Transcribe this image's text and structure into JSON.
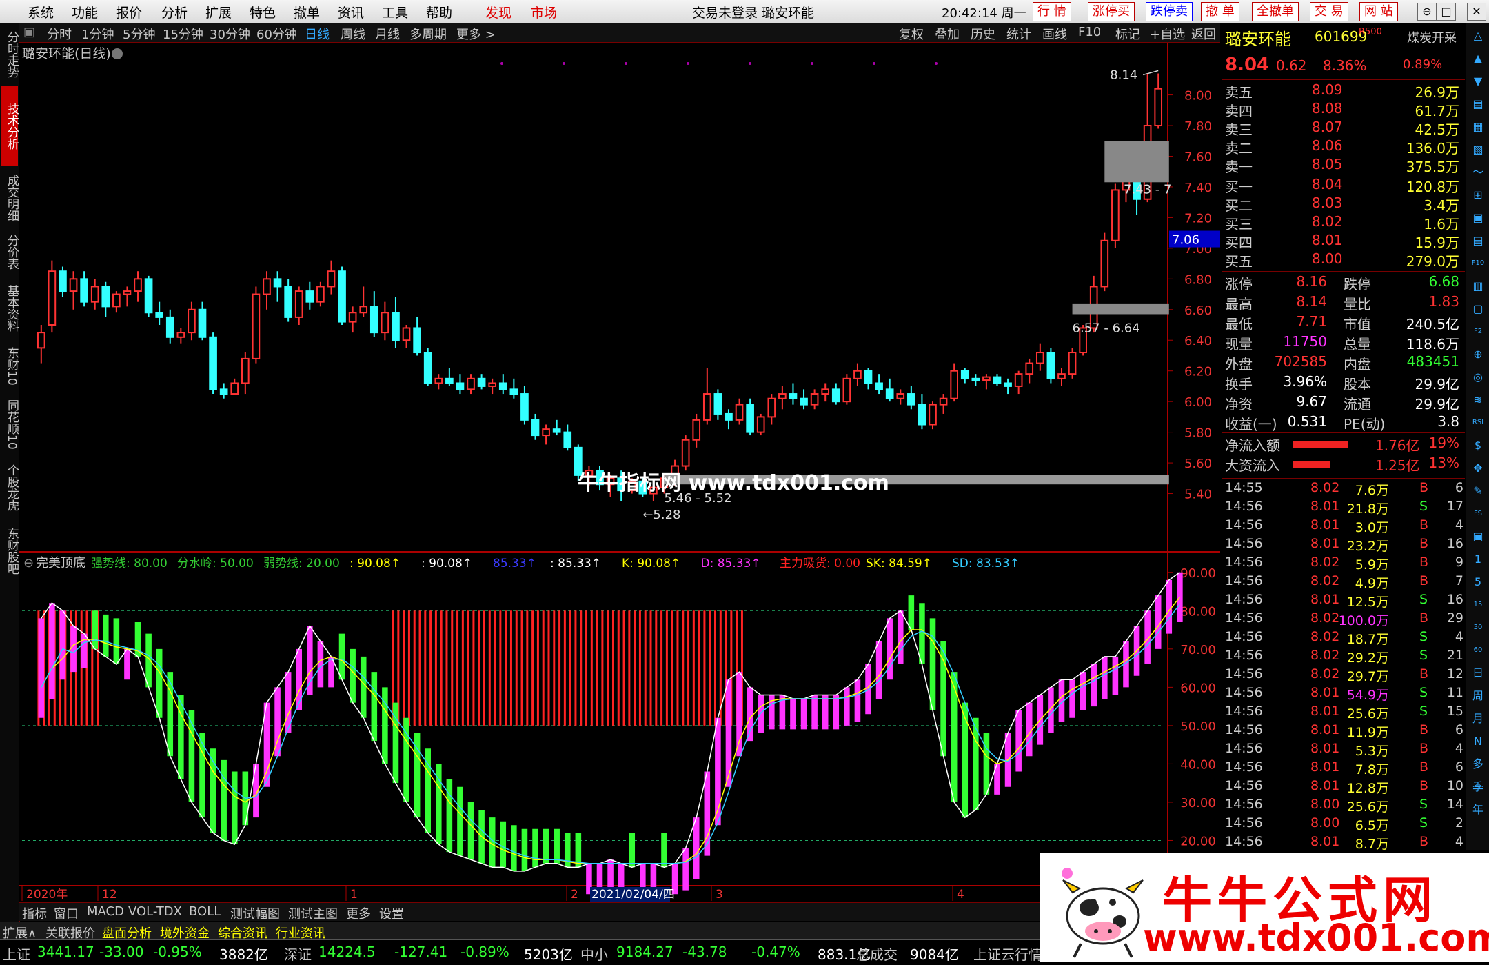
{
  "menu": {
    "items": [
      "系统",
      "功能",
      "报价",
      "分析",
      "扩展",
      "特色",
      "撤单",
      "资讯",
      "工具",
      "帮助"
    ],
    "highlight_items": [
      "发现",
      "市场"
    ],
    "window_title": "交易未登录 璐安环能",
    "time": "20:42:14 周一",
    "trade_buttons": [
      "行 情",
      "涨停买",
      "跌停卖",
      "撤 单",
      "全撤单",
      "交 易",
      "网 站"
    ],
    "window_buttons": [
      "⊖",
      "□",
      "❐",
      "✕"
    ]
  },
  "left_tabs": [
    "分时走势",
    "技术分析",
    "成交明细",
    "分价表",
    "基本资料",
    "东财10",
    "同花顺10",
    "个股龙虎",
    "东财股吧"
  ],
  "period_bar": {
    "items": [
      "分时",
      "1分钟",
      "5分钟",
      "15分钟",
      "30分钟",
      "60分钟",
      "日线",
      "周线",
      "月线",
      "多周期",
      "更多 >"
    ],
    "active": "日线",
    "right_items": [
      "复权",
      "叠加",
      "历史",
      "统计",
      "画线",
      "F10",
      "标记",
      "+自选",
      "返回"
    ]
  },
  "chart": {
    "stock_title": "璐安环能(日线)",
    "price_axis": [
      "8.00",
      "7.80",
      "7.60",
      "7.40",
      "7.20",
      "7.00",
      "6.80",
      "6.60",
      "6.40",
      "6.20",
      "6.00",
      "5.80",
      "5.60",
      "5.40"
    ],
    "current_price_tag": "7.06",
    "high_label": "8.14",
    "low_label": "5.28",
    "zones": [
      "7.43 - 7",
      "6.57 - 6.64",
      "5.46 - 5.52"
    ],
    "watermark": "牛牛指标网 www.tdx001.com",
    "indicator_title": "完美顶底",
    "indicator_values": [
      {
        "label": "强势线: 80.00",
        "color": "#33cc33"
      },
      {
        "label": "分水岭: 50.00",
        "color": "#33cc33"
      },
      {
        "label": "弱势线: 20.00",
        "color": "#33cc33"
      },
      {
        "label": ": 90.08↑",
        "color": "#ffff00"
      },
      {
        "label": ": 90.08↑",
        "color": "#ffffff"
      },
      {
        "label": "85.33↑",
        "color": "#3a3aff"
      },
      {
        "label": ": 85.33↑",
        "color": "#ffffff"
      },
      {
        "label": "K: 90.08↑",
        "color": "#ffff00"
      },
      {
        "label": "D: 85.33↑",
        "color": "#ff33ff"
      },
      {
        "label": "主力吸货: 0.00",
        "color": "#ff2222"
      },
      {
        "label": "SK: 84.59↑",
        "color": "#ffff00"
      },
      {
        "label": "SD: 83.53↑",
        "color": "#33ccff"
      }
    ],
    "indicator_axis": [
      "90.00",
      "80.00",
      "70.00",
      "60.00",
      "50.00",
      "40.00",
      "30.00",
      "20.00"
    ],
    "date_axis": [
      "2020年",
      "12",
      "1",
      "2",
      "2021/02/04/四",
      "3",
      "4"
    ]
  },
  "chart_data": {
    "type": "candlestick",
    "title": "璐安环能(日线)",
    "ylim": [
      5.2,
      8.25
    ],
    "candles": [
      [
        6.35,
        6.5,
        6.25,
        6.45
      ],
      [
        6.5,
        6.92,
        6.45,
        6.85
      ],
      [
        6.85,
        6.88,
        6.68,
        6.72
      ],
      [
        6.72,
        6.85,
        6.6,
        6.8
      ],
      [
        6.8,
        6.85,
        6.62,
        6.65
      ],
      [
        6.65,
        6.8,
        6.6,
        6.75
      ],
      [
        6.75,
        6.78,
        6.55,
        6.62
      ],
      [
        6.62,
        6.72,
        6.58,
        6.7
      ],
      [
        6.7,
        6.75,
        6.62,
        6.72
      ],
      [
        6.72,
        6.85,
        6.65,
        6.8
      ],
      [
        6.8,
        6.82,
        6.55,
        6.58
      ],
      [
        6.58,
        6.65,
        6.5,
        6.55
      ],
      [
        6.55,
        6.6,
        6.38,
        6.42
      ],
      [
        6.42,
        6.48,
        6.38,
        6.45
      ],
      [
        6.45,
        6.65,
        6.4,
        6.6
      ],
      [
        6.6,
        6.65,
        6.4,
        6.42
      ],
      [
        6.42,
        6.45,
        6.05,
        6.08
      ],
      [
        6.08,
        6.12,
        6.02,
        6.05
      ],
      [
        6.05,
        6.15,
        6.05,
        6.12
      ],
      [
        6.12,
        6.32,
        6.05,
        6.28
      ],
      [
        6.28,
        6.75,
        6.25,
        6.7
      ],
      [
        6.7,
        6.85,
        6.6,
        6.8
      ],
      [
        6.8,
        6.85,
        6.65,
        6.75
      ],
      [
        6.75,
        6.8,
        6.52,
        6.55
      ],
      [
        6.55,
        6.75,
        6.5,
        6.72
      ],
      [
        6.72,
        6.78,
        6.6,
        6.65
      ],
      [
        6.65,
        6.78,
        6.62,
        6.75
      ],
      [
        6.75,
        6.92,
        6.7,
        6.85
      ],
      [
        6.85,
        6.88,
        6.5,
        6.52
      ],
      [
        6.52,
        6.62,
        6.45,
        6.58
      ],
      [
        6.58,
        6.75,
        6.55,
        6.62
      ],
      [
        6.62,
        6.72,
        6.42,
        6.45
      ],
      [
        6.45,
        6.65,
        6.4,
        6.58
      ],
      [
        6.58,
        6.68,
        6.35,
        6.4
      ],
      [
        6.4,
        6.5,
        6.35,
        6.48
      ],
      [
        6.48,
        6.55,
        6.3,
        6.32
      ],
      [
        6.32,
        6.35,
        6.1,
        6.12
      ],
      [
        6.12,
        6.18,
        6.08,
        6.15
      ],
      [
        6.15,
        6.22,
        6.1,
        6.12
      ],
      [
        6.12,
        6.18,
        6.05,
        6.08
      ],
      [
        6.08,
        6.18,
        6.05,
        6.15
      ],
      [
        6.15,
        6.18,
        6.08,
        6.1
      ],
      [
        6.1,
        6.15,
        6.05,
        6.12
      ],
      [
        6.12,
        6.18,
        6.05,
        6.08
      ],
      [
        6.08,
        6.15,
        6.02,
        6.05
      ],
      [
        6.05,
        6.1,
        5.85,
        5.88
      ],
      [
        5.88,
        5.92,
        5.75,
        5.78
      ],
      [
        5.78,
        5.85,
        5.72,
        5.82
      ],
      [
        5.82,
        5.88,
        5.78,
        5.8
      ],
      [
        5.8,
        5.85,
        5.68,
        5.7
      ],
      [
        5.7,
        5.72,
        5.48,
        5.52
      ],
      [
        5.52,
        5.58,
        5.45,
        5.55
      ],
      [
        5.55,
        5.58,
        5.42,
        5.46
      ],
      [
        5.46,
        5.52,
        5.38,
        5.5
      ],
      [
        5.5,
        5.55,
        5.35,
        5.42
      ],
      [
        5.42,
        5.5,
        5.4,
        5.48
      ],
      [
        5.48,
        5.5,
        5.38,
        5.4
      ],
      [
        5.4,
        5.48,
        5.35,
        5.44
      ],
      [
        5.44,
        5.52,
        5.4,
        5.5
      ],
      [
        5.5,
        5.62,
        5.45,
        5.58
      ],
      [
        5.58,
        5.78,
        5.55,
        5.75
      ],
      [
        5.75,
        5.92,
        5.7,
        5.88
      ],
      [
        5.88,
        6.22,
        5.85,
        6.05
      ],
      [
        6.05,
        6.08,
        5.88,
        5.92
      ],
      [
        5.92,
        5.95,
        5.82,
        5.88
      ],
      [
        5.88,
        6.02,
        5.85,
        5.98
      ],
      [
        5.98,
        6.02,
        5.78,
        5.8
      ],
      [
        5.8,
        5.92,
        5.78,
        5.9
      ],
      [
        5.9,
        6.05,
        5.85,
        6.02
      ],
      [
        6.02,
        6.1,
        5.95,
        6.05
      ],
      [
        6.05,
        6.12,
        5.98,
        6.02
      ],
      [
        6.02,
        6.08,
        5.95,
        5.98
      ],
      [
        5.98,
        6.08,
        5.95,
        6.05
      ],
      [
        6.05,
        6.12,
        6.0,
        6.08
      ],
      [
        6.08,
        6.12,
        5.98,
        6.0
      ],
      [
        6.0,
        6.18,
        5.98,
        6.15
      ],
      [
        6.15,
        6.25,
        6.1,
        6.2
      ],
      [
        6.2,
        6.22,
        6.08,
        6.12
      ],
      [
        6.12,
        6.18,
        6.05,
        6.08
      ],
      [
        6.08,
        6.15,
        6.0,
        6.02
      ],
      [
        6.02,
        6.08,
        5.98,
        6.05
      ],
      [
        6.05,
        6.1,
        5.95,
        5.98
      ],
      [
        5.98,
        6.05,
        5.82,
        5.85
      ],
      [
        5.85,
        6.0,
        5.82,
        5.98
      ],
      [
        5.98,
        6.05,
        5.92,
        6.02
      ],
      [
        6.02,
        6.25,
        6.0,
        6.2
      ],
      [
        6.2,
        6.22,
        6.12,
        6.15
      ],
      [
        6.15,
        6.18,
        6.1,
        6.14
      ],
      [
        6.14,
        6.18,
        6.08,
        6.16
      ],
      [
        6.16,
        6.18,
        6.1,
        6.12
      ],
      [
        6.12,
        6.15,
        6.05,
        6.1
      ],
      [
        6.1,
        6.2,
        6.05,
        6.18
      ],
      [
        6.18,
        6.28,
        6.12,
        6.25
      ],
      [
        6.25,
        6.38,
        6.2,
        6.32
      ],
      [
        6.32,
        6.35,
        6.12,
        6.15
      ],
      [
        6.15,
        6.22,
        6.1,
        6.18
      ],
      [
        6.18,
        6.35,
        6.15,
        6.32
      ],
      [
        6.32,
        6.5,
        6.3,
        6.48
      ],
      [
        6.48,
        6.82,
        6.45,
        6.75
      ],
      [
        6.75,
        7.1,
        6.72,
        7.05
      ],
      [
        7.05,
        7.42,
        7.0,
        7.38
      ],
      [
        7.38,
        7.62,
        7.3,
        7.55
      ],
      [
        7.55,
        7.62,
        7.22,
        7.32
      ],
      [
        7.32,
        8.14,
        7.3,
        7.8
      ],
      [
        7.8,
        8.14,
        7.78,
        8.04
      ]
    ],
    "indicator": {
      "name": "完美顶底",
      "ylim": [
        10,
        95
      ],
      "levels": [
        80,
        50,
        20
      ],
      "K": [
        78,
        82,
        80,
        76,
        74,
        70,
        68,
        66,
        70,
        68,
        60,
        52,
        42,
        36,
        30,
        26,
        22,
        20,
        19,
        24,
        40,
        56,
        60,
        64,
        70,
        76,
        72,
        68,
        62,
        56,
        52,
        46,
        40,
        35,
        30,
        26,
        22,
        19,
        17,
        16,
        15,
        14,
        13,
        13,
        12,
        12,
        13,
        14,
        14,
        13,
        13,
        14,
        14,
        15,
        14,
        13,
        14,
        14,
        13,
        14,
        18,
        26,
        38,
        52,
        62,
        64,
        60,
        58,
        58,
        58,
        57,
        57,
        58,
        58,
        58,
        60,
        62,
        66,
        72,
        78,
        80,
        75,
        66,
        54,
        42,
        30,
        26,
        28,
        32,
        40,
        48,
        54,
        56,
        58,
        60,
        62,
        62,
        64,
        66,
        68,
        68,
        72,
        76,
        80,
        84,
        88,
        90
      ],
      "D": [
        60,
        65,
        70,
        72,
        73,
        72,
        71,
        70,
        70,
        69,
        66,
        62,
        56,
        50,
        46,
        40,
        36,
        33,
        30,
        30,
        34,
        42,
        50,
        56,
        62,
        66,
        68,
        68,
        66,
        62,
        60,
        56,
        52,
        48,
        44,
        40,
        36,
        32,
        28,
        26,
        22,
        20,
        18,
        17,
        16,
        15,
        15,
        15,
        15,
        14,
        14,
        14,
        14,
        14,
        14,
        14,
        14,
        14,
        14,
        14,
        15,
        18,
        24,
        32,
        42,
        50,
        54,
        56,
        57,
        57,
        57,
        57,
        57,
        57,
        57,
        58,
        59,
        61,
        65,
        70,
        74,
        76,
        74,
        70,
        64,
        56,
        48,
        44,
        40,
        40,
        42,
        46,
        50,
        53,
        56,
        59,
        60,
        62,
        63,
        65,
        66,
        68,
        71,
        74,
        78,
        82,
        85
      ]
    }
  },
  "quote": {
    "name": "璐安环能",
    "code": "601699",
    "r_tag": "R500",
    "sector_tag": "煤炭开采",
    "price": "8.04",
    "change": "0.62",
    "pct": "8.36%",
    "sector_pct": "0.89%",
    "sells": [
      {
        "label": "卖五",
        "price": "8.09",
        "vol": "26.9万"
      },
      {
        "label": "卖四",
        "price": "8.08",
        "vol": "61.7万"
      },
      {
        "label": "卖三",
        "price": "8.07",
        "vol": "42.5万"
      },
      {
        "label": "卖二",
        "price": "8.06",
        "vol": "136.0万"
      },
      {
        "label": "卖一",
        "price": "8.05",
        "vol": "375.5万"
      }
    ],
    "buys": [
      {
        "label": "买一",
        "price": "8.04",
        "vol": "120.8万"
      },
      {
        "label": "买二",
        "price": "8.03",
        "vol": "3.4万"
      },
      {
        "label": "买三",
        "price": "8.02",
        "vol": "1.6万"
      },
      {
        "label": "买四",
        "price": "8.01",
        "vol": "15.9万"
      },
      {
        "label": "买五",
        "price": "8.00",
        "vol": "279.0万"
      }
    ],
    "stats": [
      {
        "l1": "涨停",
        "v1": "8.16",
        "c1": "#ff3333",
        "l2": "跌停",
        "v2": "6.68",
        "c2": "#33ff33"
      },
      {
        "l1": "最高",
        "v1": "8.14",
        "c1": "#ff3333",
        "l2": "量比",
        "v2": "1.83",
        "c2": "#ff3333"
      },
      {
        "l1": "最低",
        "v1": "7.71",
        "c1": "#ff3333",
        "l2": "市值",
        "v2": "240.5亿",
        "c2": "#ffffff"
      },
      {
        "l1": "现量",
        "v1": "11750",
        "c1": "#ff33ff",
        "l2": "总量",
        "v2": "118.6万",
        "c2": "#ffffff"
      },
      {
        "l1": "外盘",
        "v1": "702585",
        "c1": "#ff3333",
        "l2": "内盘",
        "v2": "483451",
        "c2": "#33ff33"
      },
      {
        "l1": "换手",
        "v1": "3.96%",
        "c1": "#ffffff",
        "l2": "股本",
        "v2": "29.9亿",
        "c2": "#ffffff"
      },
      {
        "l1": "净资",
        "v1": "9.67",
        "c1": "#ffffff",
        "l2": "流通",
        "v2": "29.9亿",
        "c2": "#ffffff"
      },
      {
        "l1": "收益(一)",
        "v1": "0.531",
        "c1": "#ffffff",
        "l2": "PE(动)",
        "v2": "3.8",
        "c2": "#ffffff"
      }
    ],
    "flows": [
      {
        "label": "净流入额",
        "value": "1.76亿",
        "pct": "19%",
        "bar": 0.19
      },
      {
        "label": "大资流入",
        "value": "1.25亿",
        "pct": "13%",
        "bar": 0.13
      }
    ],
    "ticks": [
      [
        "14:55",
        "8.02",
        "7.6万",
        "B",
        "6"
      ],
      [
        "14:56",
        "8.01",
        "21.8万",
        "S",
        "17"
      ],
      [
        "14:56",
        "8.01",
        "3.0万",
        "B",
        "4"
      ],
      [
        "14:56",
        "8.01",
        "23.2万",
        "B",
        "16"
      ],
      [
        "14:56",
        "8.02",
        "5.9万",
        "B",
        "9"
      ],
      [
        "14:56",
        "8.02",
        "4.9万",
        "B",
        "7"
      ],
      [
        "14:56",
        "8.01",
        "12.5万",
        "S",
        "16"
      ],
      [
        "14:56",
        "8.02",
        "100.0万",
        "B",
        "29"
      ],
      [
        "14:56",
        "8.02",
        "18.7万",
        "S",
        "4"
      ],
      [
        "14:56",
        "8.02",
        "29.2万",
        "S",
        "21"
      ],
      [
        "14:56",
        "8.02",
        "29.7万",
        "B",
        "12"
      ],
      [
        "14:56",
        "8.01",
        "54.9万",
        "S",
        "11"
      ],
      [
        "14:56",
        "8.01",
        "25.6万",
        "S",
        "15"
      ],
      [
        "14:56",
        "8.01",
        "11.9万",
        "B",
        "6"
      ],
      [
        "14:56",
        "8.01",
        "5.3万",
        "B",
        "4"
      ],
      [
        "14:56",
        "8.01",
        "7.8万",
        "B",
        "6"
      ],
      [
        "14:56",
        "8.01",
        "12.8万",
        "B",
        "10"
      ],
      [
        "14:56",
        "8.00",
        "25.6万",
        "S",
        "14"
      ],
      [
        "14:56",
        "8.00",
        "6.5万",
        "S",
        "2"
      ],
      [
        "14:56",
        "8.01",
        "8.7万",
        "B",
        "4"
      ]
    ]
  },
  "right_icons": [
    "△",
    "▲",
    "▼",
    "▤",
    "▦",
    "▧",
    "〜",
    "⊞",
    "▣",
    "▤",
    "F10",
    "▥",
    "▢",
    "F2",
    "⊕",
    "◎",
    "≋",
    "RSI",
    "$",
    "✥",
    "✎",
    "FS",
    "▣",
    "1",
    "5",
    "15",
    "30",
    "60",
    "日",
    "周",
    "月",
    "N",
    "多",
    "季",
    "年"
  ],
  "bottom_tabs": [
    "指标",
    "窗口",
    "MACD",
    "VOL-TDX",
    "BOLL",
    "测试幅图",
    "测试主图",
    "更多",
    "设置"
  ],
  "bottom_tabs2": [
    "扩展∧",
    "关联报价",
    "盘面分析",
    "境外资金",
    "综合资讯",
    "行业资讯"
  ],
  "status": [
    {
      "t": "上证",
      "c": "#c8c8c8"
    },
    {
      "t": "3441.17",
      "c": "#33ff33"
    },
    {
      "t": "-33.00",
      "c": "#33ff33"
    },
    {
      "t": "-0.95%",
      "c": "#33ff33"
    },
    {
      "t": "3882亿",
      "c": "#ffffff"
    },
    {
      "t": "深证",
      "c": "#c8c8c8"
    },
    {
      "t": "14224.5",
      "c": "#33ff33"
    },
    {
      "t": "-127.41",
      "c": "#33ff33"
    },
    {
      "t": "-0.89%",
      "c": "#33ff33"
    },
    {
      "t": "5203亿",
      "c": "#ffffff"
    },
    {
      "t": "中小",
      "c": "#c8c8c8"
    },
    {
      "t": "9184.27",
      "c": "#33ff33"
    },
    {
      "t": "-43.78",
      "c": "#33ff33"
    },
    {
      "t": "-0.47%",
      "c": "#33ff33"
    },
    {
      "t": "883.1亿",
      "c": "#ffffff"
    },
    {
      "t": "总成交",
      "c": "#c8c8c8"
    },
    {
      "t": "9084亿",
      "c": "#ffffff"
    },
    {
      "t": "上证云行情",
      "c": "#c8c8c8"
    }
  ],
  "banner": {
    "title": "牛牛公式网",
    "url": "www.tdx001.com"
  }
}
